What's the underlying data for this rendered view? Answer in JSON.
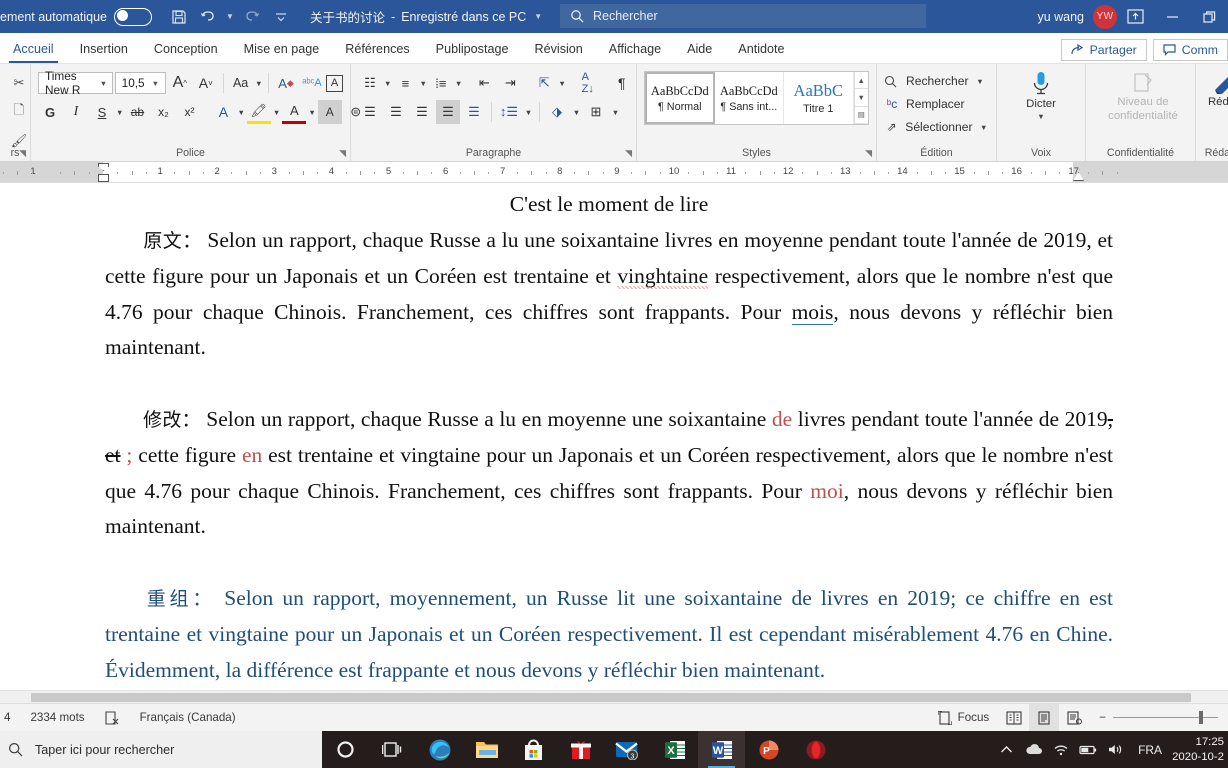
{
  "titlebar": {
    "autosave_label": "ement automatique",
    "autosave_state": "off",
    "document_title": "关于书的讨论",
    "save_location": "Enregistré dans ce PC",
    "search_placeholder": "Rechercher",
    "user_name": "yu wang",
    "user_initials": "YW",
    "save_icon": "save-icon",
    "undo_icon": "undo-icon",
    "redo_icon": "redo-icon",
    "customize_icon": "chevron-down-icon",
    "ribbon_display_icon": "ribbon-display-options-icon",
    "minimize_icon": "minimize-icon",
    "restore_icon": "restore-icon"
  },
  "ribbon_tabs": [
    {
      "label": "Accueil",
      "active": true
    },
    {
      "label": "Insertion",
      "active": false
    },
    {
      "label": "Conception",
      "active": false
    },
    {
      "label": "Mise en page",
      "active": false
    },
    {
      "label": "Références",
      "active": false
    },
    {
      "label": "Publipostage",
      "active": false
    },
    {
      "label": "Révision",
      "active": false
    },
    {
      "label": "Affichage",
      "active": false
    },
    {
      "label": "Aide",
      "active": false
    },
    {
      "label": "Antidote",
      "active": false
    }
  ],
  "ribbon_right": {
    "share_label": "Partager",
    "share_icon": "share-icon",
    "comments_label": "Comm",
    "comments_icon": "comment-icon"
  },
  "ribbon": {
    "groups": [
      {
        "name": "Presse-papiers",
        "label": "rs",
        "launcher": true
      },
      {
        "name": "Police",
        "label": "Police",
        "launcher": true
      },
      {
        "name": "Paragraphe",
        "label": "Paragraphe",
        "launcher": true
      },
      {
        "name": "Styles",
        "label": "Styles",
        "launcher": true
      },
      {
        "name": "Édition",
        "label": "Édition",
        "launcher": false
      },
      {
        "name": "Voix",
        "label": "Voix",
        "launcher": false
      },
      {
        "name": "Confidentialité",
        "label": "Confidentialité",
        "launcher": false
      },
      {
        "name": "Rédacteur",
        "label": "Rédact",
        "launcher": false
      }
    ],
    "font": {
      "family_value": "Times New R",
      "size_value": "10,5",
      "grow_font": "A",
      "shrink_font": "A",
      "change_case": "Aa",
      "clear_format_icon": "clear-formatting-icon",
      "phonetic_icon": "phonetic-guide-icon",
      "border_icon": "character-border-icon",
      "bold_label": "G",
      "italic_label": "I",
      "underline_label": "S",
      "strike_label": "ab",
      "subscript_label": "x₂",
      "superscript_label": "x²",
      "text_effects_label": "A",
      "highlight_label": "A",
      "font_color_label": "A",
      "shading_label": "A",
      "text_fill_label": "A"
    },
    "paragraph": {
      "bullets_icon": "bullet-list-icon",
      "numbering_icon": "numbered-list-icon",
      "multilevel_icon": "multilevel-list-icon",
      "decrease_indent_icon": "decrease-indent-icon",
      "increase_indent_icon": "increase-indent-icon",
      "asian_layout_icon": "asian-layout-icon",
      "sort_icon": "sort-icon",
      "show_marks_icon": "paragraph-mark-icon",
      "align_left_icon": "align-left-icon",
      "align_center_icon": "align-center-icon",
      "align_right_icon": "align-right-icon",
      "justify_icon": "justify-icon",
      "distribute_icon": "distribute-icon",
      "line_spacing_icon": "line-spacing-icon",
      "shading_icon": "shading-icon",
      "borders_icon": "borders-icon"
    },
    "styles": [
      {
        "preview": "AaBbCcDd",
        "name": "¶ Normal",
        "active": true
      },
      {
        "preview": "AaBbCcDd",
        "name": "¶ Sans int...",
        "active": false
      },
      {
        "preview": "AaBbC",
        "name": "Titre 1",
        "active": false
      }
    ],
    "edition": [
      {
        "label": "Rechercher",
        "icon": "search-icon",
        "caret": true
      },
      {
        "label": "Remplacer",
        "icon": "replace-icon",
        "caret": false
      },
      {
        "label": "Sélectionner",
        "icon": "select-icon",
        "caret": true
      }
    ],
    "voice": {
      "label": "Dicter",
      "icon": "microphone-icon"
    },
    "sensitivity": {
      "label_line1": "Niveau de",
      "label_line2": "confidentialité",
      "icon": "sensitivity-icon",
      "disabled": true
    },
    "editor": {
      "label": "Rédact",
      "icon": "editor-pen-icon"
    }
  },
  "ruler": {
    "left_numbers": [
      "1"
    ],
    "numbers": [
      "1",
      "2",
      "3",
      "4",
      "5",
      "6",
      "7",
      "8",
      "9",
      "10",
      "11",
      "12",
      "13",
      "14",
      "15",
      "16",
      "17"
    ]
  },
  "document": {
    "title": "C'est le moment de lire",
    "paragraphs": [
      {
        "id": "original",
        "label": "原文：",
        "color": "black",
        "text_before_spell": "  Selon un rapport, chaque Russe a lu une soixantaine livres en moyenne pendant toute l'année de 2019, et cette figure pour un Japonais et un Coréen est trentaine et ",
        "spell_word": "vinghtaine",
        "text_after_spell": " respectivement, alors que le nombre n'est que 4.76 pour chaque Chinois. Franchement, ces chiffres sont frappants. Pour ",
        "grammar_word": "mois",
        "text_end": ", nous devons y réfléchir bien maintenant."
      },
      {
        "id": "revised",
        "label": "修改：",
        "color": "black",
        "seg1": "  Selon un rapport, chaque Russe a lu en moyenne une soixantaine ",
        "edit1": "de",
        "seg2": " livres pendant toute l'année de 2019",
        "strike1": ", et",
        "seg3": " ",
        "edit2": ";",
        "seg4": " cette figure ",
        "edit3": "en",
        "seg5": " est trentaine et vingtaine pour un Japonais et un Coréen respectivement, alors que le nombre n'est que 4.76 pour chaque Chinois. Franchement, ces chiffres sont frappants. Pour ",
        "edit4": "moi",
        "seg6": ", nous devons y réfléchir bien maintenant."
      },
      {
        "id": "rewritten",
        "label": "重组：",
        "color": "blue",
        "text": "  Selon un rapport, moyennement, un Russe lit une soixantaine de livres en 2019; ce chiffre en est trentaine et vingtaine pour un Japonais et un Coréen respectivement. Il est cependant misérablement 4.76 en Chine. Évidemment, la différence est frappante et nous devons y réfléchir bien maintenant."
      }
    ]
  },
  "statusbar": {
    "page_partial": "4",
    "word_count": "2334 mots",
    "proofing_icon": "proofing-errors-icon",
    "language": "Français (Canada)",
    "focus_label": "Focus",
    "focus_icon": "focus-mode-icon",
    "read_mode_icon": "read-mode-icon",
    "print_layout_icon": "print-layout-icon",
    "web_layout_icon": "web-layout-icon",
    "zoom_out_label": "−",
    "zoom_in_label": "+"
  },
  "taskbar": {
    "search_placeholder": "Taper ici pour rechercher",
    "search_icon": "search-icon",
    "items": [
      {
        "name": "cortana-icon",
        "glyph": "◯",
        "active": false
      },
      {
        "name": "task-view-icon",
        "glyph": "▤",
        "active": false
      },
      {
        "name": "microsoft-edge-icon",
        "glyph": "",
        "active": false
      },
      {
        "name": "file-explorer-icon",
        "glyph": "",
        "active": false
      },
      {
        "name": "microsoft-store-icon",
        "glyph": "",
        "active": false
      },
      {
        "name": "gift-icon",
        "glyph": "",
        "active": false
      },
      {
        "name": "mail-icon",
        "glyph": "",
        "badge": "3",
        "active": false
      },
      {
        "name": "microsoft-excel-icon",
        "glyph": "X",
        "active": false
      },
      {
        "name": "microsoft-word-icon",
        "glyph": "W",
        "active": true
      },
      {
        "name": "microsoft-powerpoint-icon",
        "glyph": "P",
        "active": false
      },
      {
        "name": "opera-icon",
        "glyph": "",
        "active": false
      }
    ],
    "tray": {
      "expand_icon": "show-hidden-icons-icon",
      "onedrive_icon": "onedrive-icon",
      "network_icon": "wifi-icon",
      "battery_icon": "battery-icon",
      "volume_icon": "volume-icon",
      "language": "FRA",
      "time": "17:25",
      "date": "2020-10-2"
    }
  },
  "colors": {
    "title_bar": "#2b579a",
    "accent": "#2b579a",
    "edit_red": "#c0504d",
    "rewrite_blue": "#1f4e79",
    "taskbar": "#251d1c"
  }
}
